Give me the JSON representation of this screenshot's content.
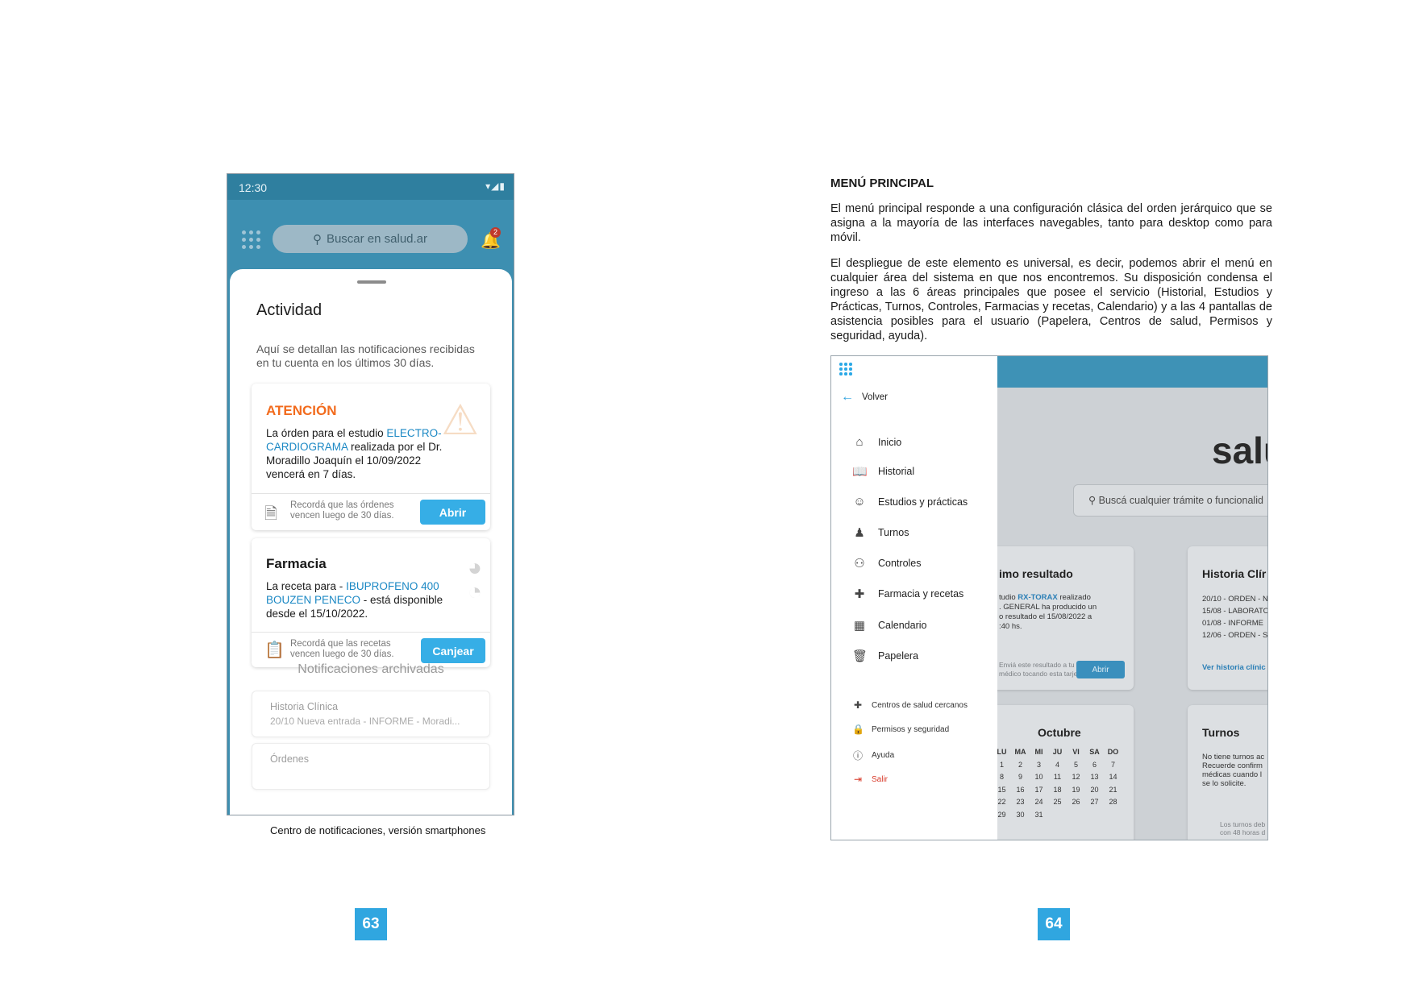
{
  "left_page": {
    "phone": {
      "status_time": "12:30",
      "status_icons": "▾◢▮",
      "search_placeholder": "Buscar en salud.ar",
      "notification_count": "2",
      "sheet_title": "Actividad",
      "sheet_description": "Aquí se detallan las notificaciones recibidas en tu cuenta en los últimos 30 días.",
      "card1": {
        "title": "ATENCIÓN",
        "body_pre": "La órden para el estudio ",
        "body_hl": "ELECTRO-CARDIOGRAMA",
        "body_post": " realizada por el Dr. Moradillo Joaquín el 10/09/2022 vencerá en 7 días.",
        "foot_text": "Recordá que las órdenes vencen luego de 30 días.",
        "button": "Abrir",
        "title_color": "#f26b1d"
      },
      "card2": {
        "title": "Farmacia",
        "body_pre": "La receta para - ",
        "body_hl": "IBUPROFENO 400 BOUZEN PENECO",
        "body_post": " - está disponible desde el 15/10/2022.",
        "foot_text": "Recordá que las recetas vencen luego de 30 días.",
        "button": "Canjear"
      },
      "archived_title": "Notificaciones archivadas",
      "archived": [
        {
          "title": "Historia Clínica",
          "subtitle": "20/10 Nueva entrada - INFORME - Moradi..."
        },
        {
          "title": "Órdenes",
          "subtitle": ""
        }
      ]
    },
    "caption": "Centro de notificaciones, versión smartphones",
    "page_number": "63"
  },
  "right_page": {
    "heading": "MENÚ PRINCIPAL",
    "paragraph1": "El menú principal responde a una configuración clásica del orden jerárquico que se asigna a la mayoría de las interfaces navegables, tanto para desktop como para móvil.",
    "paragraph2": "El despliegue de este elemento es universal, es decir, podemos abrir el menú en cualquier área del sistema en que nos encontremos. Su disposición condensa el ingreso a las 6 áreas principales que posee el servicio (Historial, Estudios y Prácticas, Turnos, Controles, Farmacias y recetas, Calendario) y a las 4 pantallas de asistencia posibles para el usuario (Papelera, Centros de salud, Permisos y seguridad, ayuda).",
    "menu": {
      "back": "Volver",
      "items": [
        {
          "label": "Inicio",
          "icon": "home-icon"
        },
        {
          "label": "Historial",
          "icon": "book-icon"
        },
        {
          "label": "Estudios y prácticas",
          "icon": "body-icon"
        },
        {
          "label": "Turnos",
          "icon": "people-icon"
        },
        {
          "label": "Controles",
          "icon": "doctor-icon"
        },
        {
          "label": "Farmacia y recetas",
          "icon": "pharmacy-icon"
        },
        {
          "label": "Calendario",
          "icon": "calendar-icon"
        },
        {
          "label": "Papelera",
          "icon": "trash-icon"
        }
      ],
      "secondary": [
        {
          "label": "Centros de salud cercanos",
          "icon": "health-center-icon"
        },
        {
          "label": "Permisos y seguridad",
          "icon": "lock-icon"
        },
        {
          "label": "Ayuda",
          "icon": "help-icon"
        },
        {
          "label": "Salir",
          "icon": "logout-icon"
        }
      ]
    },
    "background": {
      "brand": "salu",
      "search_placeholder": "Buscá cualquier trámite o funcionalid",
      "result_card": {
        "title": "imo resultado",
        "line1_pre": "tudio ",
        "line1_hl": "RX-TORAX",
        "line1_post": " realizado",
        "line2": ". GENERAL ha producido un",
        "line3": "o resultado el 15/08/2022 a",
        "line4": ":40 hs.",
        "foot1": "Enviá este resultado a tu",
        "foot2": "médico tocando esta tarjeta.",
        "button": "Abrir"
      },
      "historia_card": {
        "title": "Historia Clír",
        "rows": [
          "20/10 - ORDEN - N",
          "15/08 - LABORATO",
          "01/08 - INFORME",
          "12/06 - ORDEN - S"
        ],
        "link": "Ver historia clínic"
      },
      "calendar": {
        "title": "Octubre",
        "days": [
          "LU",
          "MA",
          "MI",
          "JU",
          "VI",
          "SA",
          "DO"
        ],
        "weeks": [
          [
            "1",
            "2",
            "3",
            "4",
            "5",
            "6",
            "7"
          ],
          [
            "8",
            "9",
            "10",
            "11",
            "12",
            "13",
            "14"
          ],
          [
            "15",
            "16",
            "17",
            "18",
            "19",
            "20",
            "21"
          ],
          [
            "22",
            "23",
            "24",
            "25",
            "26",
            "27",
            "28"
          ],
          [
            "29",
            "30",
            "31",
            "",
            "",
            "",
            ""
          ]
        ]
      },
      "turnos_card": {
        "title": "Turnos",
        "lines": [
          "No tiene turnos ac",
          "Recuerde confirm",
          "médicas cuando l",
          "se lo solicite."
        ],
        "foot1": "Los turnos deb",
        "foot2": "con 48 horas d"
      }
    },
    "page_number": "64"
  }
}
